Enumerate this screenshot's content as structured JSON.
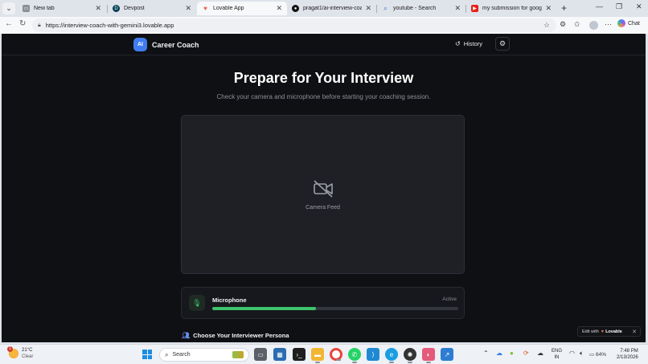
{
  "browser": {
    "tabs": [
      {
        "title": "New tab",
        "active": false,
        "icon": "window-icon"
      },
      {
        "title": "Devpost",
        "active": false,
        "icon": "devpost-icon"
      },
      {
        "title": "Lovable App",
        "active": true,
        "icon": "lovable-heart-icon"
      },
      {
        "title": "pragat1/ai-interview-coach",
        "active": false,
        "icon": "github-icon"
      },
      {
        "title": "youtube - Search",
        "active": false,
        "icon": "search-icon"
      },
      {
        "title": "my submission for google ge",
        "active": false,
        "icon": "youtube-icon"
      }
    ],
    "url": "https://interview-coach-with-gemini3.lovable.app",
    "chat_label": "Chat"
  },
  "app": {
    "brand_badge": "AI",
    "brand_name": "Career Coach",
    "history_label": "History",
    "title": "Prepare for Your Interview",
    "subtitle": "Check your camera and microphone before starting your coaching session.",
    "camera_label": "Camera Feed",
    "microphone": {
      "label": "Microphone",
      "status": "Active",
      "level": 0.42
    },
    "persona_label": "Choose Your Interviewer Persona",
    "lovable": {
      "edit_with": "Edit with",
      "brand": "Lovable"
    }
  },
  "taskbar": {
    "weather_temp": "21°C",
    "weather_cond": "Clear",
    "weather_alert": "1",
    "search_label": "Search",
    "lang_line1": "ENG",
    "lang_line2": "IN",
    "battery": "64%",
    "time": "7:48 PM",
    "date": "2/13/2026"
  },
  "colors": {
    "page_bg": "#0f1013",
    "accent_blue": "#3f7df0",
    "mic_green": "#3ec46d",
    "card_bg": "#1e2026"
  }
}
